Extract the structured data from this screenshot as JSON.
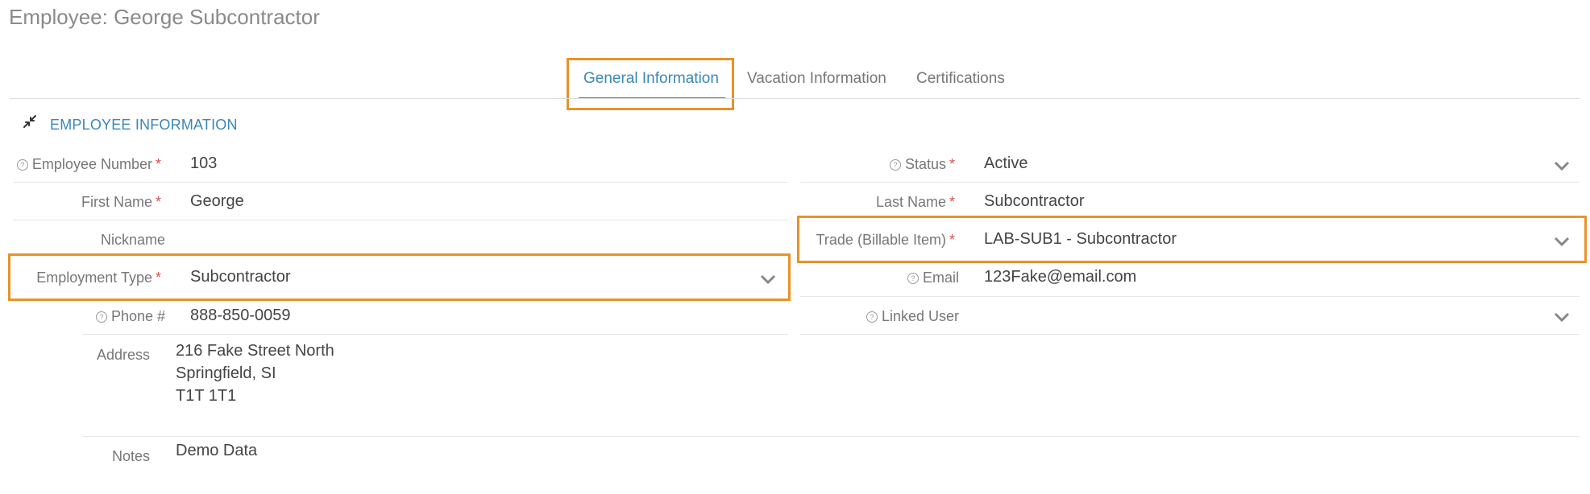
{
  "page": {
    "title": "Employee: George Subcontractor"
  },
  "tabs": [
    {
      "label": "General Information",
      "active": true
    },
    {
      "label": "Vacation Information",
      "active": false
    },
    {
      "label": "Certifications",
      "active": false
    }
  ],
  "section": {
    "title": "EMPLOYEE INFORMATION",
    "icon": "collapse-arrows-icon"
  },
  "required_mark": "*",
  "fields": {
    "employee_number": {
      "label": "Employee Number",
      "value": "103"
    },
    "status": {
      "label": "Status",
      "value": "Active"
    },
    "first_name": {
      "label": "First Name",
      "value": "George"
    },
    "last_name": {
      "label": "Last Name",
      "value": "Subcontractor"
    },
    "nickname": {
      "label": "Nickname",
      "value": ""
    },
    "trade": {
      "label": "Trade (Billable Item)",
      "value": "LAB-SUB1 - Subcontractor"
    },
    "employment_type": {
      "label": "Employment Type",
      "value": "Subcontractor"
    },
    "email": {
      "label": "Email",
      "value": "123Fake@email.com"
    },
    "phone": {
      "label": "Phone #",
      "value": "888-850-0059"
    },
    "linked_user": {
      "label": "Linked User",
      "value": ""
    },
    "address": {
      "label": "Address",
      "lines": [
        "216 Fake Street North",
        "Springfield, SI",
        "T1T 1T1"
      ]
    },
    "notes": {
      "label": "Notes",
      "value": "Demo Data"
    }
  },
  "colors": {
    "accent": "#3a87b8",
    "highlight": "#e8922a",
    "required": "#d9534f"
  }
}
